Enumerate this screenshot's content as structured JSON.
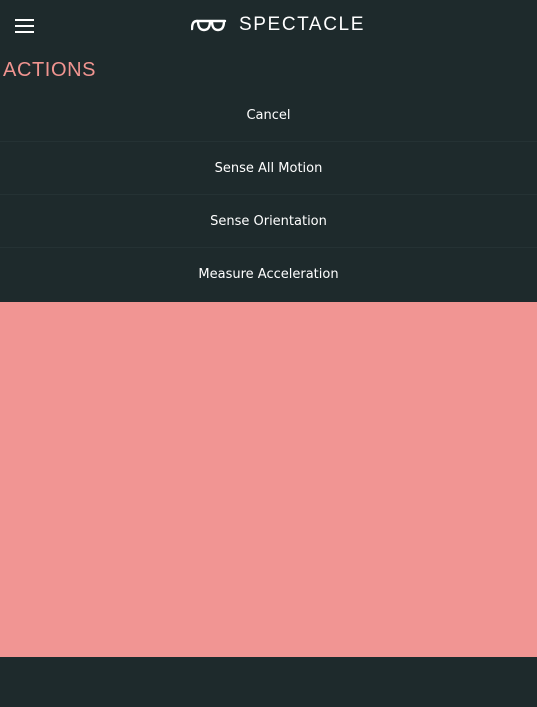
{
  "header": {
    "brand_name": "SPECTACLE",
    "menu_icon": "hamburger-icon",
    "logo_icon": "glasses-icon"
  },
  "actions_section": {
    "title": "ACTIONS",
    "items": [
      {
        "label": "Cancel"
      },
      {
        "label": "Sense All Motion"
      },
      {
        "label": "Sense Orientation"
      },
      {
        "label": "Measure Acceleration"
      }
    ]
  },
  "colors": {
    "background": "#1e2a2c",
    "accent": "#f09490",
    "panel": "#f19593",
    "text": "#ffffff"
  }
}
